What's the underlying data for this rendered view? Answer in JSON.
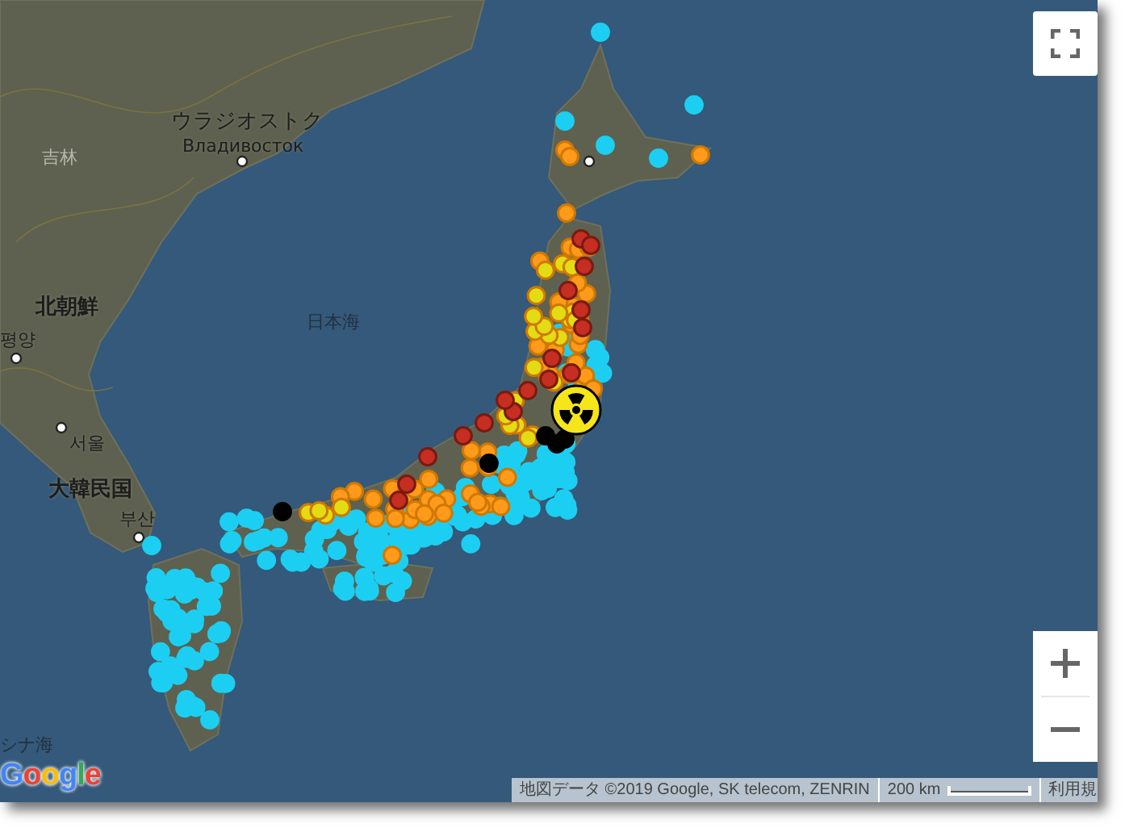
{
  "map": {
    "place_labels": [
      {
        "text": "ウラジオストク",
        "kind": "city-large"
      },
      {
        "text": "Владивосток",
        "kind": "city"
      },
      {
        "text": "吉林",
        "kind": "province"
      },
      {
        "text": "北朝鮮",
        "kind": "country"
      },
      {
        "text": "평양",
        "kind": "city"
      },
      {
        "text": "서울",
        "kind": "city"
      },
      {
        "text": "大韓民国",
        "kind": "country"
      },
      {
        "text": "부산",
        "kind": "city"
      },
      {
        "text": "日本海",
        "kind": "sea"
      },
      {
        "text": "シナ海",
        "kind": "sea"
      }
    ],
    "logo": "Google",
    "attribution": {
      "text": "地図データ ©2019 Google, SK telecom, ZENRIN",
      "scale": "200 km",
      "terms": "利用規"
    }
  }
}
